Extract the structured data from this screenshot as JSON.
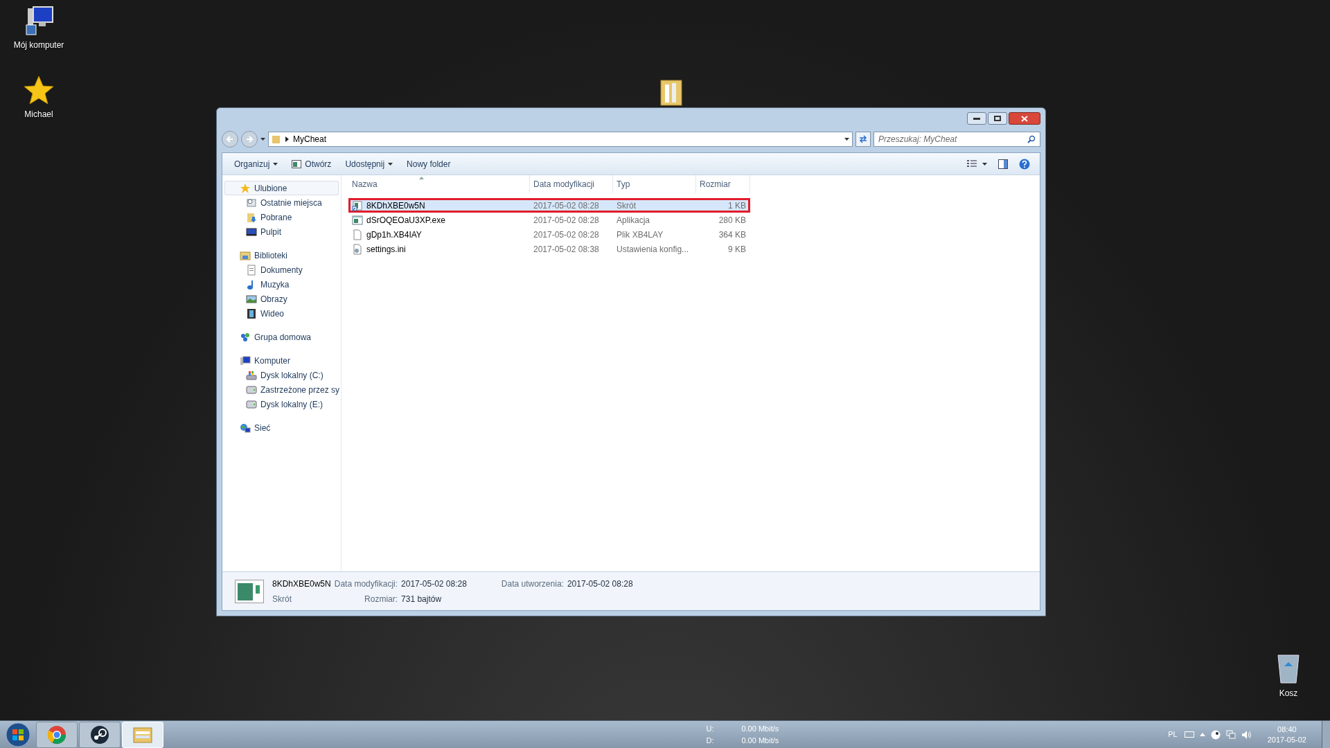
{
  "desktop_icons": [
    {
      "kind": "computer",
      "label": "Mój komputer"
    },
    {
      "kind": "star",
      "label": "Michael"
    },
    {
      "kind": "folder"
    },
    {
      "kind": "bin",
      "label": "Kosz"
    }
  ],
  "window": {
    "address": "MyCheat",
    "search": {
      "placeholder": "Przeszukaj: MyCheat"
    },
    "toolbar": [
      {
        "label": "Organizuj",
        "kind": "menu"
      },
      {
        "label": "Otwórz",
        "kind": "open"
      },
      {
        "label": "Udostępnij",
        "kind": "menu"
      },
      {
        "label": "Nowy folder",
        "kind": "plain"
      }
    ],
    "navigation": [
      {
        "label": "Ulubione",
        "kind": "star",
        "selected": true,
        "children": [
          {
            "label": "Ostatnie miejsca",
            "kind": "recent",
            "selected": false
          },
          {
            "label": "Pobrane",
            "kind": "download",
            "selected": false
          },
          {
            "label": "Pulpit",
            "kind": "desktop",
            "selected": false
          }
        ]
      },
      {
        "label": "Biblioteki",
        "kind": "library",
        "selected": false,
        "children": [
          {
            "label": "Dokumenty",
            "kind": "document",
            "selected": false
          },
          {
            "label": "Muzyka",
            "kind": "music",
            "selected": false
          },
          {
            "label": "Obrazy",
            "kind": "image",
            "selected": false
          },
          {
            "label": "Wideo",
            "kind": "video",
            "selected": false
          }
        ]
      },
      {
        "label": "Grupa domowa",
        "kind": "homegroup",
        "selected": false
      },
      {
        "label": "Komputer",
        "kind": "computer",
        "selected": false,
        "children": [
          {
            "label": "Dysk lokalny (C:)",
            "kind": "systemdrive",
            "selected": false
          },
          {
            "label": "Zastrzeżone przez sy",
            "kind": "drive",
            "selected": false
          },
          {
            "label": "Dysk lokalny (E:)",
            "kind": "drive",
            "selected": false
          }
        ]
      },
      {
        "label": "Sieć",
        "kind": "network",
        "selected": false
      }
    ],
    "columns": [
      "Nazwa",
      "Data modyfikacji",
      "Typ",
      "Rozmiar"
    ],
    "files": [
      {
        "name": "8KDhXBE0w5N",
        "modified": "2017-05-02 08:28",
        "type": "Skrót",
        "size": "1 KB",
        "kind": "shortcut",
        "selected": true
      },
      {
        "name": "dSrOQEOaU3XP.exe",
        "modified": "2017-05-02 08:28",
        "type": "Aplikacja",
        "size": "280 KB",
        "kind": "app",
        "selected": false
      },
      {
        "name": "gDp1h.XB4IAY",
        "modified": "2017-05-02 08:28",
        "type": "Plik XB4LAY",
        "size": "364 KB",
        "kind": "file",
        "selected": false
      },
      {
        "name": "settings.ini",
        "modified": "2017-05-02 08:38",
        "type": "Ustawienia konfig...",
        "size": "9 KB",
        "kind": "settings",
        "selected": false
      }
    ],
    "details": {
      "name": "8KDhXBE0w5N",
      "type": "Skrót",
      "fields": [
        {
          "label": "Data modyfikacji:",
          "value": "2017-05-02 08:28"
        },
        {
          "label": "Data utworzenia:",
          "value": "2017-05-02 08:28"
        },
        {
          "label": "Rozmiar:",
          "value": "731 bajtów"
        }
      ]
    }
  },
  "taskbar": {
    "apps": [
      {
        "kind": "chrome",
        "active": false
      },
      {
        "kind": "steam",
        "active": false
      },
      {
        "kind": "explorer",
        "active": true
      }
    ],
    "network": [
      {
        "label": "U:",
        "value": "0.00 Mbit/s"
      },
      {
        "label": "D:",
        "value": "0.00 Mbit/s"
      }
    ],
    "language": "PL",
    "time": "08:40",
    "date": "2017-05-02"
  }
}
